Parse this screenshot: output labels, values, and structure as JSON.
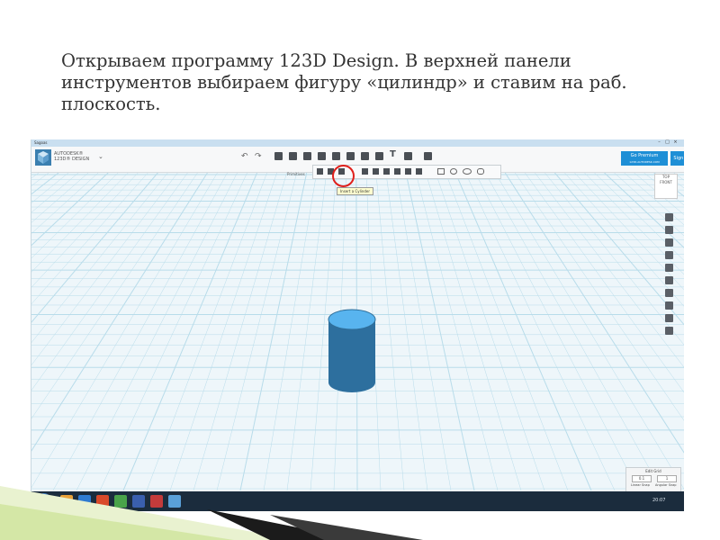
{
  "caption": "Открываем программу 123D Design. В верхней панели инструментов выбираем фигуру «цилиндр» и ставим на раб. плоскость.",
  "app": {
    "titlebar_tag": "Sagoas",
    "brand_line1": "AUTODESK®",
    "brand_line2": "123D® DESIGN",
    "premium_label": "Go Premium",
    "premium_sub": "123D.AUTODESK.COM",
    "signin_label": "Sign In"
  },
  "toolbar": {
    "primitives_label": "Primitives",
    "tooltip": "Insert a Cylinder"
  },
  "viewcube": {
    "top": "TOP",
    "mid": "FRONT"
  },
  "edit_grid": {
    "title": "Edit Grid",
    "linear_value": "0.1",
    "angular_value": "1",
    "linear_label": "Linear Snap",
    "angular_label": "Angular Snap"
  },
  "taskbar": {
    "clock": "20:07"
  },
  "colors": {
    "grid_bg": "#eef6fa",
    "grid_line": "#b8dcea",
    "cylinder_top": "#58b4ef",
    "cylinder_side": "#2d6f9e",
    "highlight": "#e0201b",
    "accent": "#1e8fd6"
  }
}
